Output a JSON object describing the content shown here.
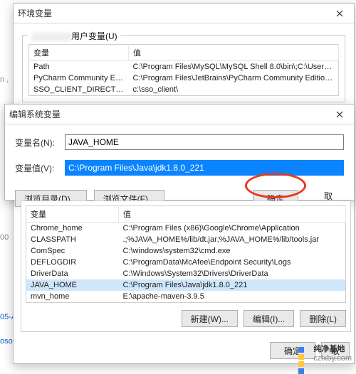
{
  "env_window": {
    "title": "环境变量",
    "group_legend_suffix": "用户变量(U)",
    "table": {
      "headers": {
        "var": "变量",
        "value": "值"
      },
      "rows": [
        {
          "var": "Path",
          "value": "C:\\Program Files\\MySQL\\MySQL Shell 8.0\\bin\\;C:\\Users\\0110..."
        },
        {
          "var": "PyCharm Community Editi...",
          "value": "C:\\Program Files\\JetBrains\\PyCharm Community Edition 2021...."
        },
        {
          "var": "SSO_CLIENT_DIRECTORY",
          "value": "c:\\sso_client\\"
        }
      ]
    }
  },
  "edit_window": {
    "title": "编辑系统变量",
    "name_label": "变量名(N):",
    "value_label": "变量值(V):",
    "name_value": "JAVA_HOME",
    "value_value": "C:\\Program Files\\Java\\jdk1.8.0_221",
    "browse_dir": "浏览目录(D)...",
    "browse_file": "浏览文件(F)...",
    "ok": "确定",
    "cancel": "取消"
  },
  "sys_section": {
    "table": {
      "headers": {
        "var": "变量",
        "value": "值"
      },
      "rows": [
        {
          "var": "Chrome_home",
          "value": "C:\\Program Files (x86)\\Google\\Chrome\\Application",
          "selected": false
        },
        {
          "var": "CLASSPATH",
          "value": ".;%JAVA_HOME%/lib/dt.jar;%JAVA_HOME%/lib/tools.jar",
          "selected": false
        },
        {
          "var": "ComSpec",
          "value": "C:\\windows\\system32\\cmd.exe",
          "selected": false
        },
        {
          "var": "DEFLOGDIR",
          "value": "C:\\ProgramData\\McAfee\\Endpoint Security\\Logs",
          "selected": false
        },
        {
          "var": "DriverData",
          "value": "C:\\Windows\\System32\\Drivers\\DriverData",
          "selected": false
        },
        {
          "var": "JAVA_HOME",
          "value": "C:\\Program Files\\Java\\jdk1.8.0_221",
          "selected": true
        },
        {
          "var": "mvn_home",
          "value": "E:\\apache-maven-3.9.5",
          "selected": false
        }
      ]
    },
    "buttons": {
      "new": "新建(W)...",
      "edit": "编辑(I)...",
      "delete": "删除(L)"
    },
    "bottom": {
      "ok": "确定",
      "cancel": "取"
    }
  },
  "fragments": {
    "a": "n ,",
    "b": "00",
    "c": "05-A…",
    "d": "osof"
  },
  "watermark": {
    "text": "纯净基地",
    "url": "czlxby.com"
  }
}
